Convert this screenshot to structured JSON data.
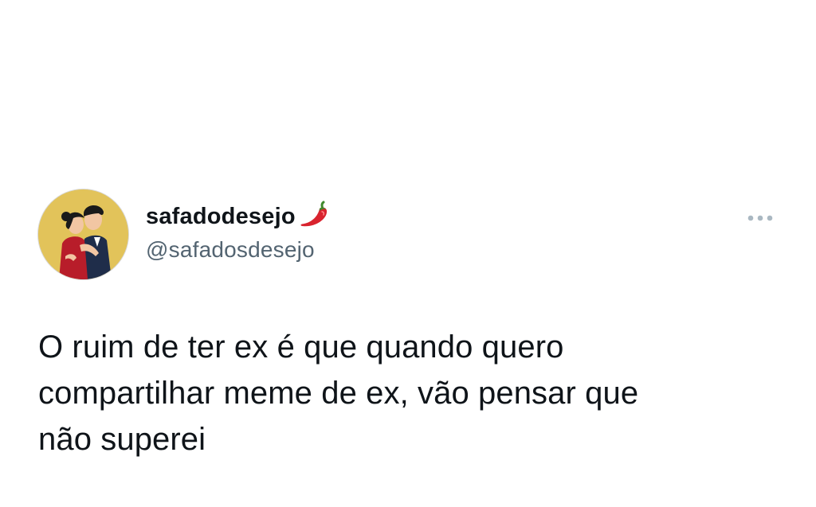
{
  "author": {
    "display_name": "safadodesejo",
    "handle": "@safadosdesejo",
    "name_emoji": "hot-pepper-icon",
    "avatar": "couple-kissing-illustration"
  },
  "menu": {
    "icon": "more-horizontal-icon"
  },
  "tweet": {
    "text": "O ruim de ter ex é que quando quero\ncompartilhar meme de ex, vão pensar que\nnão superei"
  },
  "colors": {
    "text_primary": "#0f1419",
    "text_secondary": "#536471",
    "avatar_background": "#e2c35a",
    "pepper_red": "#d9232e"
  }
}
